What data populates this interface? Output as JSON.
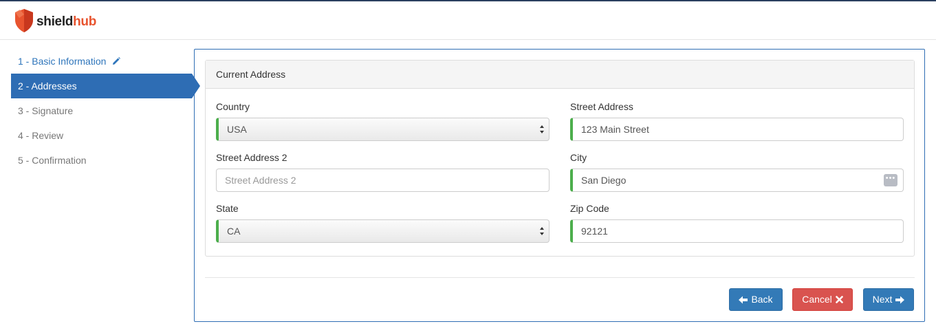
{
  "brand": {
    "shield": "shield",
    "hub": "hub",
    "accent": "#e8542f"
  },
  "steps": [
    {
      "label": "1 - Basic Information",
      "state": "done",
      "icon": "pencil-icon"
    },
    {
      "label": "2 - Addresses",
      "state": "active"
    },
    {
      "label": "3 - Signature",
      "state": "pending"
    },
    {
      "label": "4 - Review",
      "state": "pending"
    },
    {
      "label": "5 - Confirmation",
      "state": "pending"
    }
  ],
  "panel": {
    "title": "Current Address"
  },
  "form": {
    "country": {
      "label": "Country",
      "value": "USA"
    },
    "street_address": {
      "label": "Street Address",
      "value": "123 Main Street"
    },
    "street_address_2": {
      "label": "Street Address 2",
      "value": "",
      "placeholder": "Street Address 2"
    },
    "city": {
      "label": "City",
      "value": "San Diego",
      "icon": "more-dots-icon"
    },
    "state": {
      "label": "State",
      "value": "CA"
    },
    "zip": {
      "label": "Zip Code",
      "value": "92121"
    }
  },
  "buttons": {
    "back": "Back",
    "cancel": "Cancel",
    "next": "Next"
  },
  "colors": {
    "primary": "#337ab7",
    "danger": "#d9534f",
    "valid": "#4cae4c"
  }
}
